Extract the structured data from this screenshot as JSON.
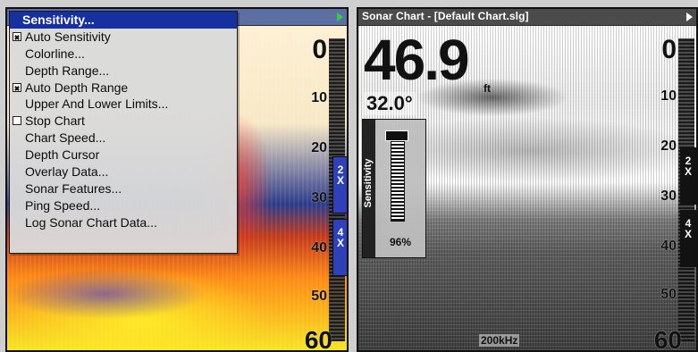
{
  "left": {
    "menu": {
      "items": [
        {
          "label": "Sensitivity...",
          "selected": true
        },
        {
          "label": "Auto Sensitivity",
          "checkbox": true,
          "checked": true
        },
        {
          "label": "Colorline..."
        },
        {
          "label": "Depth Range..."
        },
        {
          "label": "Auto Depth Range",
          "checkbox": true,
          "checked": true
        },
        {
          "label": "Upper And Lower Limits..."
        },
        {
          "label": "Stop Chart",
          "checkbox": true,
          "checked": false
        },
        {
          "label": "Chart Speed..."
        },
        {
          "label": "Depth Cursor"
        },
        {
          "label": "Overlay Data..."
        },
        {
          "label": "Sonar Features..."
        },
        {
          "label": "Ping Speed..."
        },
        {
          "label": "Log Sonar Chart Data..."
        }
      ]
    },
    "depth_scale": [
      "0",
      "10",
      "20",
      "30",
      "40",
      "50",
      "60"
    ],
    "zoom": [
      "2 X",
      "4 X"
    ],
    "colors": {
      "menu_highlight": "#1630a0",
      "zoom_bar": "#2e41b9"
    }
  },
  "right": {
    "title": "Sonar Chart - [Default Chart.slg]",
    "depth_value": "46.9",
    "depth_unit": "ft",
    "temperature": "32.0°",
    "sensitivity": {
      "label": "Sensitivity",
      "value": "96%",
      "level": 96
    },
    "frequency": "200kHz",
    "depth_scale": [
      "0",
      "10",
      "20",
      "30",
      "40",
      "50",
      "60"
    ],
    "zoom": [
      "2 X",
      "4 X"
    ],
    "colors": {
      "titlebar": "#4b4b4b",
      "zoom_bar": "#121212"
    }
  }
}
